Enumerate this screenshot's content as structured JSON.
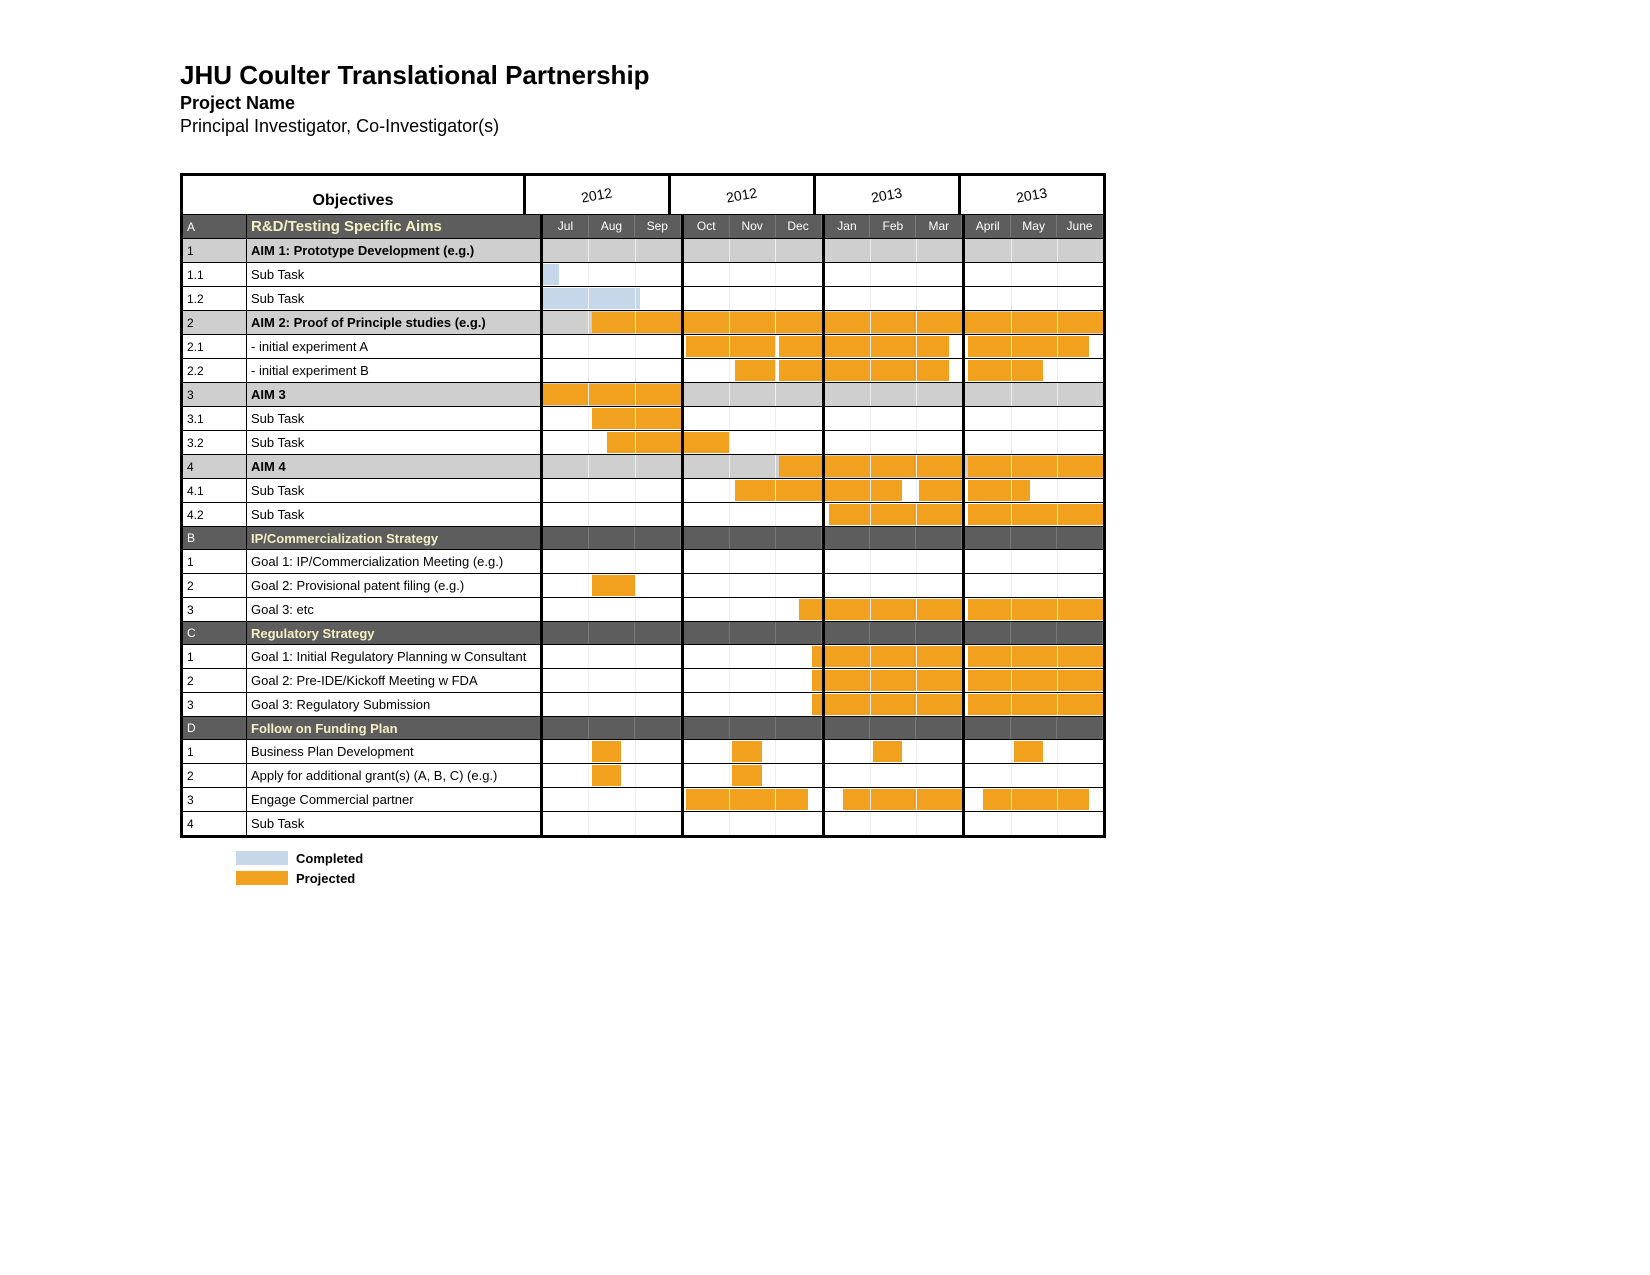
{
  "title": "JHU Coulter Translational Partnership",
  "subtitle": "Project Name",
  "investigators": "Principal Investigator, Co-Investigator(s)",
  "objectives_header": "Objectives",
  "years": [
    "2012",
    "2012",
    "2013",
    "2013"
  ],
  "months": [
    "Jul",
    "Aug",
    "Sep",
    "Oct",
    "Nov",
    "Dec",
    "Jan",
    "Feb",
    "Mar",
    "April",
    "May",
    "June"
  ],
  "legend": {
    "completed": "Completed",
    "projected": "Projected"
  },
  "chart_data": {
    "type": "gantt",
    "time_axis": {
      "months": [
        "Jul",
        "Aug",
        "Sep",
        "Oct",
        "Nov",
        "Dec",
        "Jan",
        "Feb",
        "Mar",
        "April",
        "May",
        "June"
      ],
      "year_groups": [
        {
          "year": "2012",
          "months": [
            "Jul",
            "Aug",
            "Sep"
          ]
        },
        {
          "year": "2012",
          "months": [
            "Oct",
            "Nov",
            "Dec"
          ]
        },
        {
          "year": "2013",
          "months": [
            "Jan",
            "Feb",
            "Mar"
          ]
        },
        {
          "year": "2013",
          "months": [
            "April",
            "May",
            "June"
          ]
        }
      ]
    },
    "status_colors": {
      "completed": "#c6d7ea",
      "projected": "#f2a11f"
    },
    "sections": [
      {
        "id": "A",
        "title": "R&D/Testing Specific Aims",
        "is_section_header": true,
        "rows": [
          {
            "id": "1",
            "label": "AIM 1: Prototype Development (e.g.)",
            "style": "aim",
            "bars": []
          },
          {
            "id": "1.1",
            "label": "Sub Task",
            "style": "task",
            "bars": [
              {
                "status": "completed",
                "start": 0,
                "end": 0.35
              }
            ]
          },
          {
            "id": "1.2",
            "label": "Sub Task",
            "style": "task",
            "bars": [
              {
                "status": "completed",
                "start": 0,
                "end": 2.1
              }
            ]
          },
          {
            "id": "2",
            "label": "AIM 2: Proof of Principle studies (e.g.)",
            "style": "aim",
            "bars": [
              {
                "status": "projected",
                "start": 1.05,
                "end": 12
              }
            ]
          },
          {
            "id": "2.1",
            "label": " - initial experiment A",
            "style": "task",
            "bars": [
              {
                "status": "projected",
                "start": 3.05,
                "end": 5.0
              },
              {
                "status": "projected",
                "start": 5.05,
                "end": 8.7
              },
              {
                "status": "projected",
                "start": 9.05,
                "end": 11.7
              }
            ]
          },
          {
            "id": "2.2",
            "label": " - initial experiment B",
            "style": "task",
            "bars": [
              {
                "status": "projected",
                "start": 4.1,
                "end": 5.0
              },
              {
                "status": "projected",
                "start": 5.05,
                "end": 8.7
              },
              {
                "status": "projected",
                "start": 9.05,
                "end": 10.7
              }
            ]
          },
          {
            "id": "3",
            "label": "AIM 3",
            "style": "aim",
            "bars": [
              {
                "status": "projected",
                "start": 0,
                "end": 3.0
              }
            ]
          },
          {
            "id": "3.1",
            "label": "Sub Task",
            "style": "task",
            "bars": [
              {
                "status": "projected",
                "start": 1.05,
                "end": 3.0
              }
            ]
          },
          {
            "id": "3.2",
            "label": "Sub Task",
            "style": "task",
            "bars": [
              {
                "status": "projected",
                "start": 1.4,
                "end": 4.0
              }
            ]
          },
          {
            "id": "4",
            "label": "AIM 4",
            "style": "aim",
            "bars": [
              {
                "status": "projected",
                "start": 5.05,
                "end": 9.0
              },
              {
                "status": "projected",
                "start": 9.05,
                "end": 12.0
              }
            ]
          },
          {
            "id": "4.1",
            "label": "Sub Task",
            "style": "task",
            "bars": [
              {
                "status": "projected",
                "start": 4.1,
                "end": 7.7
              },
              {
                "status": "projected",
                "start": 8.05,
                "end": 9.0
              },
              {
                "status": "projected",
                "start": 9.05,
                "end": 10.4
              }
            ]
          },
          {
            "id": "4.2",
            "label": "Sub Task",
            "style": "task",
            "bars": [
              {
                "status": "projected",
                "start": 6.1,
                "end": 9.0
              },
              {
                "status": "projected",
                "start": 9.05,
                "end": 12.0
              }
            ]
          }
        ]
      },
      {
        "id": "B",
        "title": "IP/Commercialization Strategy",
        "is_section_header": true,
        "rows": [
          {
            "id": "1",
            "label": "Goal 1: IP/Commercialization Meeting (e.g.)",
            "style": "task",
            "bars": []
          },
          {
            "id": "2",
            "label": "Goal 2: Provisional patent filing (e.g.)",
            "style": "task",
            "bars": [
              {
                "status": "projected",
                "start": 1.05,
                "end": 2.0
              }
            ]
          },
          {
            "id": "3",
            "label": "Goal 3: etc",
            "style": "task",
            "bars": [
              {
                "status": "projected",
                "start": 5.5,
                "end": 9.0
              },
              {
                "status": "projected",
                "start": 9.05,
                "end": 12.0
              }
            ]
          }
        ]
      },
      {
        "id": "C",
        "title": "Regulatory Strategy",
        "is_section_header": true,
        "rows": [
          {
            "id": "1",
            "label": "Goal 1: Initial Regulatory Planning w Consultant",
            "style": "task",
            "bars": [
              {
                "status": "projected",
                "start": 5.8,
                "end": 9.0
              },
              {
                "status": "projected",
                "start": 9.05,
                "end": 12.0
              }
            ]
          },
          {
            "id": "2",
            "label": "Goal 2: Pre-IDE/Kickoff Meeting w FDA",
            "style": "task",
            "bars": [
              {
                "status": "projected",
                "start": 5.8,
                "end": 9.0
              },
              {
                "status": "projected",
                "start": 9.05,
                "end": 12.0
              }
            ]
          },
          {
            "id": "3",
            "label": "Goal 3: Regulatory Submission",
            "style": "task",
            "bars": [
              {
                "status": "projected",
                "start": 5.8,
                "end": 9.0
              },
              {
                "status": "projected",
                "start": 9.05,
                "end": 12.0
              }
            ]
          }
        ]
      },
      {
        "id": "D",
        "title": "Follow on Funding Plan",
        "is_section_header": true,
        "rows": [
          {
            "id": "1",
            "label": "Business Plan Development",
            "style": "task",
            "bars": [
              {
                "status": "projected",
                "start": 1.05,
                "end": 1.7
              },
              {
                "status": "projected",
                "start": 4.05,
                "end": 4.7
              },
              {
                "status": "projected",
                "start": 7.05,
                "end": 7.7
              },
              {
                "status": "projected",
                "start": 10.05,
                "end": 10.7
              }
            ]
          },
          {
            "id": "2",
            "label": "Apply for additional grant(s) (A, B, C) (e.g.)",
            "style": "task",
            "bars": [
              {
                "status": "projected",
                "start": 1.05,
                "end": 1.7
              },
              {
                "status": "projected",
                "start": 4.05,
                "end": 4.7
              }
            ]
          },
          {
            "id": "3",
            "label": "Engage Commercial partner",
            "style": "task",
            "bars": [
              {
                "status": "projected",
                "start": 3.05,
                "end": 5.7
              },
              {
                "status": "projected",
                "start": 6.4,
                "end": 9.0
              },
              {
                "status": "projected",
                "start": 9.4,
                "end": 11.7
              }
            ]
          },
          {
            "id": "4",
            "label": "Sub Task",
            "style": "task",
            "bars": []
          }
        ]
      }
    ]
  }
}
